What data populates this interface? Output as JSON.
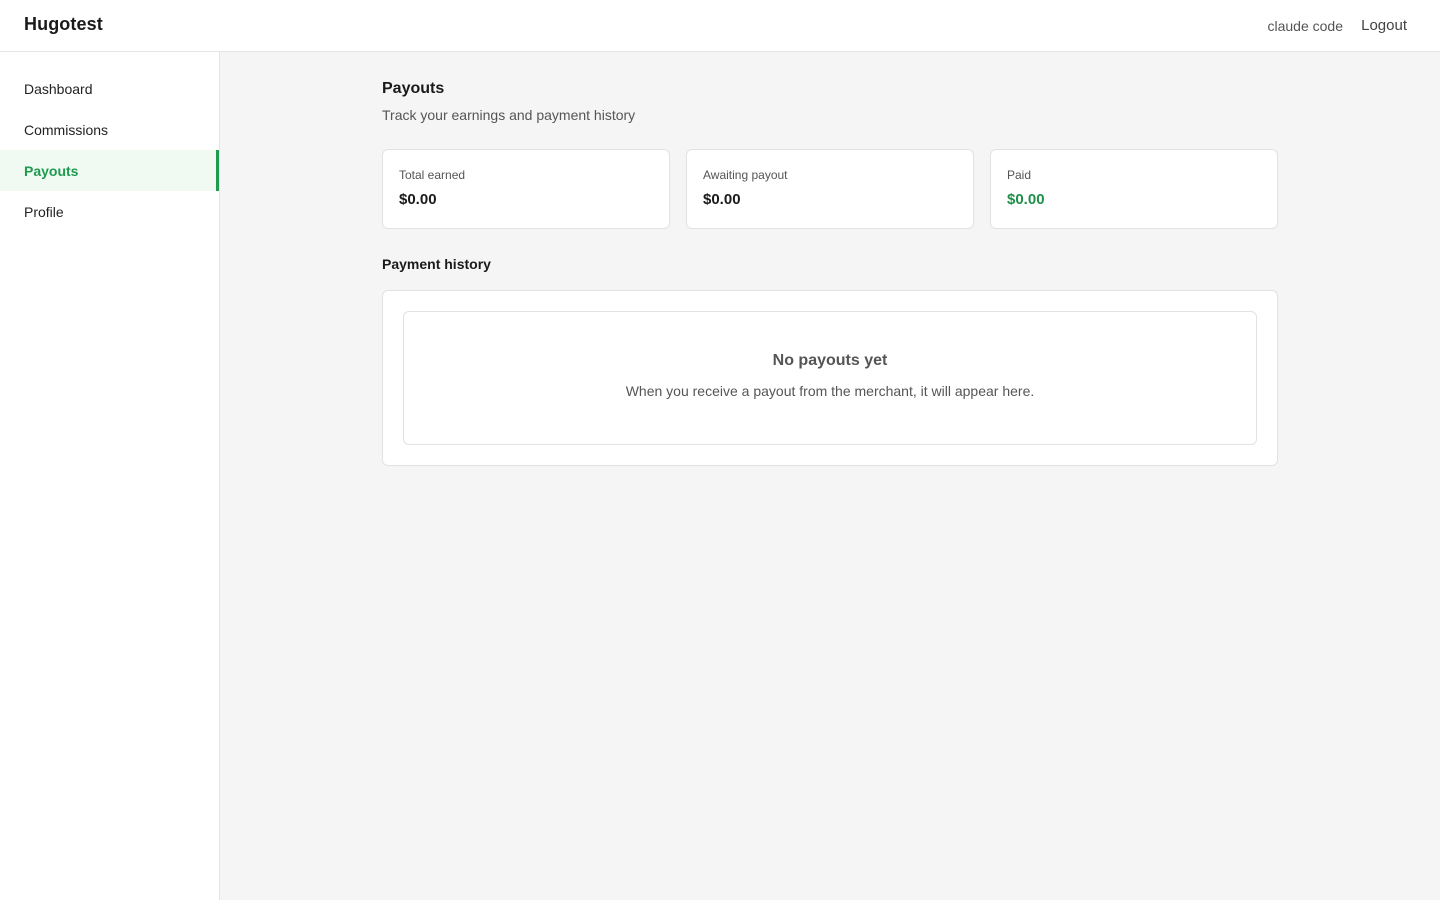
{
  "header": {
    "brand": "Hugotest",
    "user_name": "claude code",
    "logout_label": "Logout"
  },
  "sidebar": {
    "items": [
      {
        "label": "Dashboard",
        "active": false
      },
      {
        "label": "Commissions",
        "active": false
      },
      {
        "label": "Payouts",
        "active": true
      },
      {
        "label": "Profile",
        "active": false
      }
    ]
  },
  "main": {
    "title": "Payouts",
    "subtitle": "Track your earnings and payment history",
    "stats": [
      {
        "label": "Total earned",
        "value": "$0.00"
      },
      {
        "label": "Awaiting payout",
        "value": "$0.00"
      },
      {
        "label": "Paid",
        "value": "$0.00"
      }
    ],
    "history": {
      "title": "Payment history",
      "empty_title": "No payouts yet",
      "empty_text": "When you receive a payout from the merchant, it will appear here."
    }
  },
  "colors": {
    "accent": "#1f9a4f",
    "active_bg": "#f0faf3",
    "page_bg": "#f5f5f5"
  }
}
